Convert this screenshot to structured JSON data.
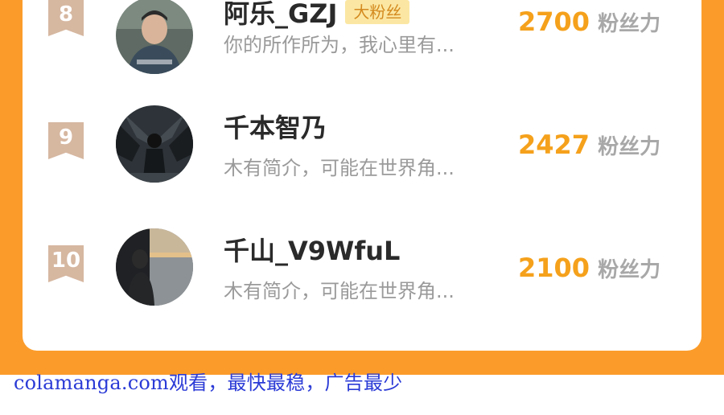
{
  "rows": [
    {
      "rank": "8",
      "name": "阿乐_GZJ",
      "badge": "大粉丝",
      "bio": "你的所作所为，我心里有...",
      "score": "2700",
      "unit": "粉丝力"
    },
    {
      "rank": "9",
      "name": "千本智乃",
      "badge": "",
      "bio": "木有简介，可能在世界角...",
      "score": "2427",
      "unit": "粉丝力"
    },
    {
      "rank": "10",
      "name": "千山_V9WfuL",
      "badge": "",
      "bio": "木有简介，可能在世界角...",
      "score": "2100",
      "unit": "粉丝力"
    }
  ],
  "watermark": "colamanga.com观看，最快最稳，广告最少",
  "colors": {
    "accent": "#fb9c2a",
    "score": "#f5a11c",
    "badge_bg": "#fbe7a3",
    "rank_badge": "#d6b7a0",
    "watermark": "#2b3bd6"
  }
}
